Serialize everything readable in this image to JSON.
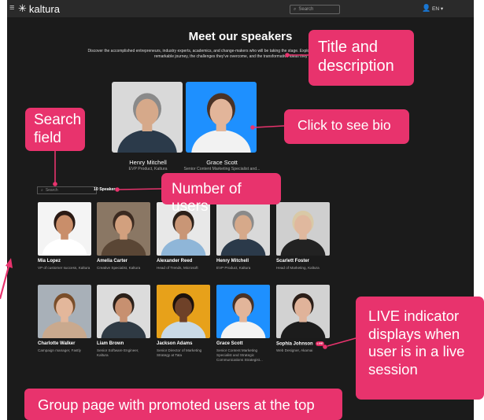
{
  "header": {
    "app_name": "kaltura",
    "search_placeholder": "Search",
    "language": "EN"
  },
  "page": {
    "title": "Meet our speakers",
    "description": "Discover the accomplished entrepreneurs, industry experts, academics, and change-makers who will be taking the stage. Explore their profiles to gain an understanding of their remarkable journey, the challenges they've overcome, and the transformative ideas they champion."
  },
  "promoted": [
    {
      "name": "Henry Mitchell",
      "role": "EVP Product, Kaltura",
      "bg": "#d9d9d9",
      "skin": "#d6a98a",
      "hair": "#8a8a8a",
      "shirt": "#2b3a4a"
    },
    {
      "name": "Grace Scott",
      "role": "Senior Content Marketing Specialist and...",
      "bg": "#1e90ff",
      "skin": "#e2b59a",
      "hair": "#4a3226",
      "shirt": "#f2f2f2"
    }
  ],
  "filter": {
    "search_placeholder": "Search",
    "count_label": "10 Speakers"
  },
  "speakers_row1": [
    {
      "name": "Mia Lopez",
      "role": "VP of customer success, Kaltura",
      "bg": "#f4f4f4",
      "skin": "#c98e6a",
      "hair": "#2a1a14",
      "shirt": "#ffffff"
    },
    {
      "name": "Amelia Carter",
      "role": "Creative Specialist, Kaltura",
      "bg": "#8a7764",
      "skin": "#d2a07e",
      "hair": "#3b2a20",
      "shirt": "#5a4635"
    },
    {
      "name": "Alexander Reed",
      "role": "Head of Trends, Microsoft",
      "bg": "#e8e8e8",
      "skin": "#c99676",
      "hair": "#2b2019",
      "shirt": "#8fb6d8"
    },
    {
      "name": "Henry Mitchell",
      "role": "EVP Product, Kaltura",
      "bg": "#d9d9d9",
      "skin": "#d6a98a",
      "hair": "#8a8a8a",
      "shirt": "#2b3a4a"
    },
    {
      "name": "Scarlett Foster",
      "role": "Head of Marketing, Kaltura",
      "bg": "#cfcfcf",
      "skin": "#e0b89e",
      "hair": "#d9c9a6",
      "shirt": "#222222"
    }
  ],
  "speakers_row2": [
    {
      "name": "Charlotte Walker",
      "role": "Campaign manager, Fastly",
      "bg": "#a8b0b8",
      "skin": "#e3b79b",
      "hair": "#7a4e2a",
      "shirt": "#c9a98e"
    },
    {
      "name": "Liam Brown",
      "role": "Senior Software Engineer, Kaltura",
      "bg": "#dcdcdc",
      "skin": "#c79070",
      "hair": "#2b2019",
      "shirt": "#2f3a44"
    },
    {
      "name": "Jackson Adams",
      "role": "Senior Director of Marketing Strategy at Tata",
      "bg": "#e7a11a",
      "skin": "#6e4128",
      "hair": "#1d120c",
      "shirt": "#c8d9e6"
    },
    {
      "name": "Grace Scott",
      "role": "Senior Content Marketing Specialist and Strategic Communications Strategist...",
      "bg": "#1e90ff",
      "skin": "#e2b59a",
      "hair": "#4a3226",
      "shirt": "#f2f2f2"
    },
    {
      "name": "Sophia Johnson",
      "role": "Web Designer, Akamai",
      "live": "LIVE",
      "bg": "#d2d2d2",
      "skin": "#e0b39a",
      "hair": "#2a1d17",
      "shirt": "#1c1c1c"
    }
  ],
  "callouts": {
    "title": "Title and description",
    "bio": "Click to see bio",
    "search": "Search field",
    "users": "Number of users",
    "live": "LIVE indicator displays when user is in a live session",
    "group": "Group page with promoted users at the top"
  },
  "colors": {
    "accent": "#e8336d",
    "background": "#1b1b1b",
    "live_badge": "#e0245e"
  }
}
